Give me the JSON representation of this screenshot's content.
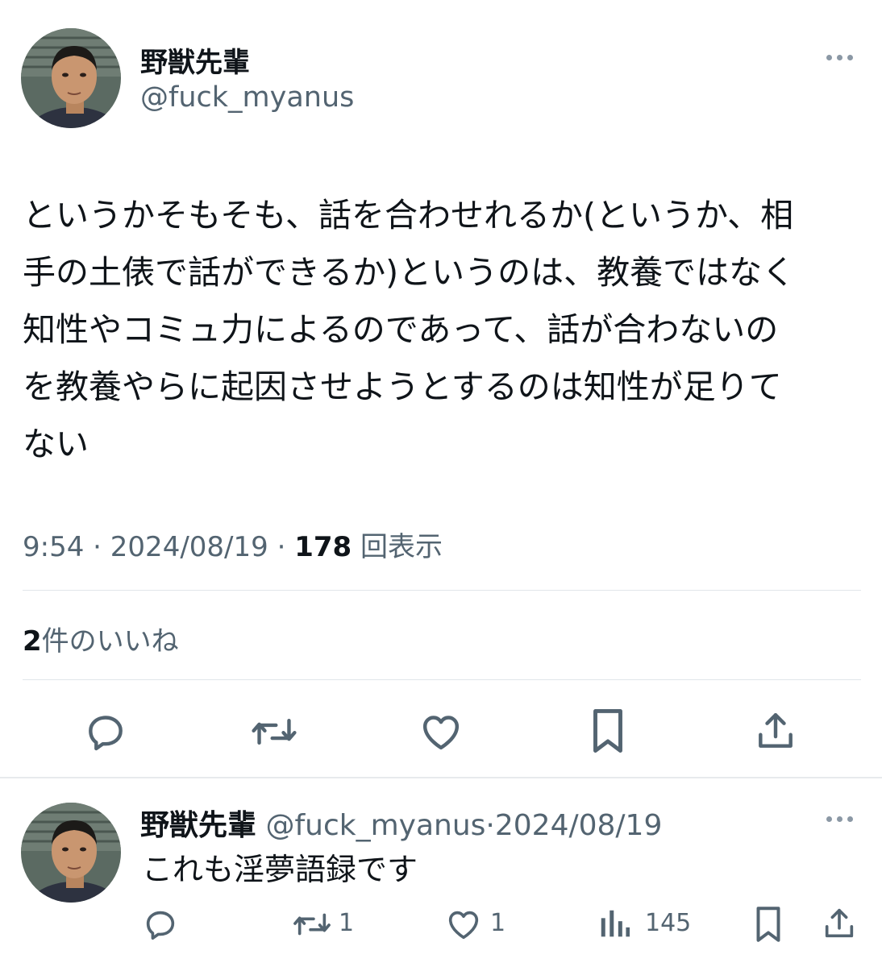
{
  "tweet": {
    "display_name": "野獣先輩",
    "handle": "@fuck_myanus",
    "text_lines": [
      "というかそもそも、話を合わせれるか(というか、相",
      "手の土俵で話ができるか)というのは、教養ではなく",
      "知性やコミュ力によるのであって、話が合わないの",
      "を教養やらに起因させようとするのは知性が足りて",
      "ない"
    ],
    "time": "9:54",
    "date": "2024/08/19",
    "views_count": "178",
    "views_label": "回表示",
    "likes_count": "2",
    "likes_label": "件のいいね"
  },
  "reply": {
    "display_name": "野獣先輩",
    "handle": "@fuck_myanus",
    "date": "2024/08/19",
    "text": "これも淫夢語録です",
    "retweet_count": "1",
    "like_count": "1",
    "views_count": "145"
  },
  "icons": {
    "more": "more-horizontal-icon",
    "reply": "reply-bubble-icon",
    "retweet": "retweet-icon",
    "like": "heart-icon",
    "bookmark": "bookmark-icon",
    "share": "share-upload-icon",
    "views": "bar-chart-icon"
  },
  "colors": {
    "text": "#0f1419",
    "secondary": "#536471",
    "icon": "#536471",
    "divider": "#e1e6ea"
  }
}
